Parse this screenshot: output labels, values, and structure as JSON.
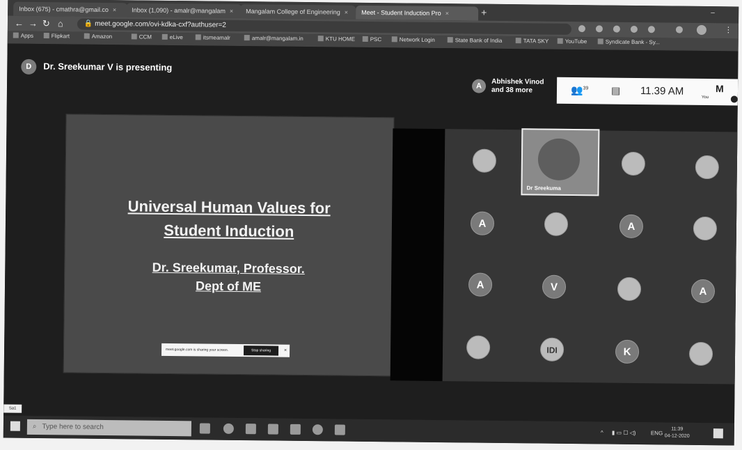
{
  "tabs": [
    {
      "label": "Inbox (675) - cmathra@gmail.co"
    },
    {
      "label": "Inbox (1,090) - amalr@mangalam"
    },
    {
      "label": "Mangalam College of Engineering"
    },
    {
      "label": "Meet - Student Induction Pro"
    }
  ],
  "address": {
    "url": "meet.google.com/ovi-kdka-cxf?authuser=2"
  },
  "bookmarks": [
    {
      "label": "Apps"
    },
    {
      "label": "Flipkart"
    },
    {
      "label": "Amazon"
    },
    {
      "label": "CCM"
    },
    {
      "label": "eLive"
    },
    {
      "label": "itsmeamalr"
    },
    {
      "label": "amalr@mangalam.in"
    },
    {
      "label": "KTU HOME"
    },
    {
      "label": "PSC"
    },
    {
      "label": "Network Login"
    },
    {
      "label": "State Bank of India"
    },
    {
      "label": "TATA SKY"
    },
    {
      "label": "YouTube"
    },
    {
      "label": "Syndicate Bank - Sy..."
    }
  ],
  "meet": {
    "presenter_initial": "D",
    "presenting_text": "Dr. Sreekumar V is presenting",
    "joiner_initial": "A",
    "joiner_line1": "Abhishek Vinod",
    "joiner_line2": "and 38 more",
    "participants_count": "39",
    "time": "11.39 AM",
    "you_label": "You",
    "video_name": "Dr Sreekuma"
  },
  "slide": {
    "title_line1": "Universal Human Values for",
    "title_line2": "Student Induction",
    "author_line1": "Dr. Sreekumar, Professor.",
    "author_line2": "Dept of ME",
    "share_message": "meet.google.com is sharing your screen.",
    "stop_sharing": "Stop sharing",
    "hide": "Hide"
  },
  "tiles": [
    {
      "label": "",
      "type": "img"
    },
    {
      "label": "",
      "type": "img"
    },
    {
      "label": "",
      "type": "img"
    },
    {
      "label": "A",
      "type": "letter"
    },
    {
      "label": "",
      "type": "img"
    },
    {
      "label": "A",
      "type": "letter"
    },
    {
      "label": "",
      "type": "img"
    },
    {
      "label": "A",
      "type": "letter"
    },
    {
      "label": "V",
      "type": "letter"
    },
    {
      "label": "",
      "type": "img"
    },
    {
      "label": "A",
      "type": "letter"
    },
    {
      "label": "",
      "type": "img"
    },
    {
      "label": "IDI",
      "type": "img"
    },
    {
      "label": "K",
      "type": "letter"
    },
    {
      "label": "",
      "type": "img"
    }
  ],
  "taskbar": {
    "search_placeholder": "Type here to search",
    "lang": "ENG",
    "clock_time": "11:39",
    "clock_date": "04-12-2020",
    "desktop_label": "Sa1"
  }
}
